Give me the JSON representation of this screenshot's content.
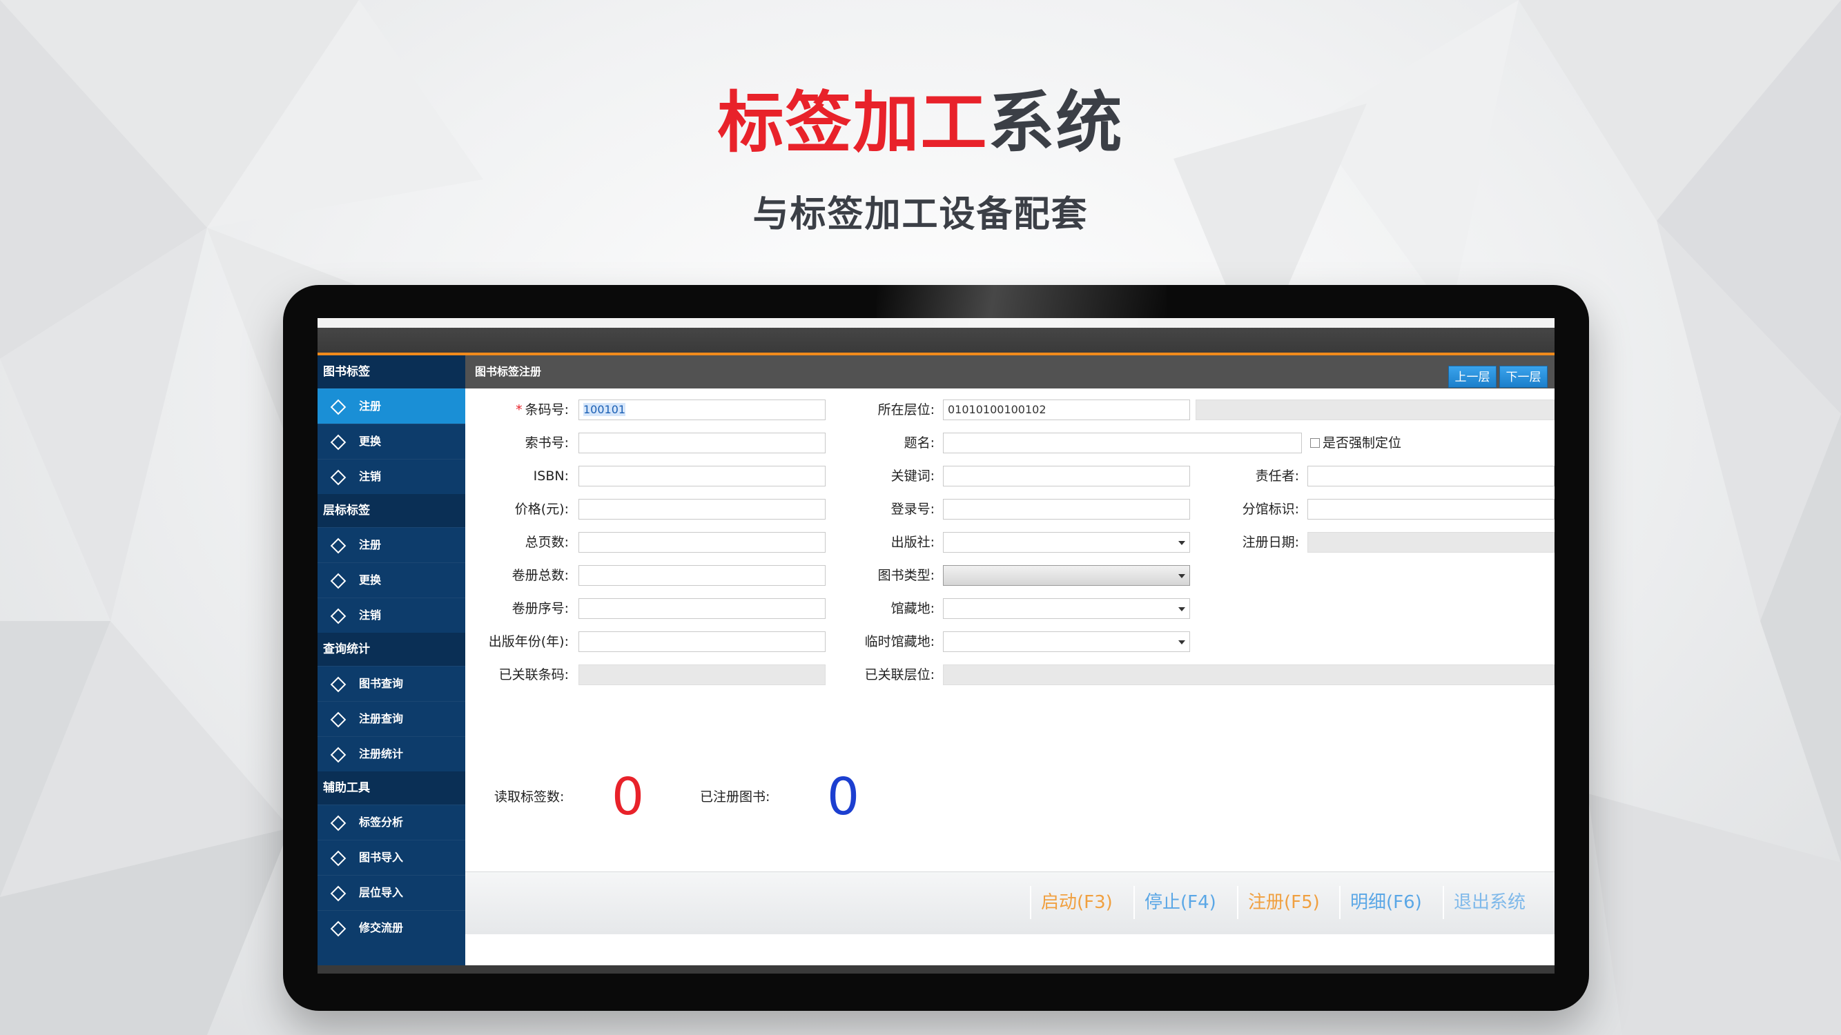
{
  "headline": {
    "accent": "标签加工",
    "rest": "系统"
  },
  "subheadline": "与标签加工设备配套",
  "app": {
    "content_title": "图书标签注册",
    "sidebar": [
      {
        "header": "图书标签",
        "items": [
          {
            "label": "注册",
            "active": true
          },
          {
            "label": "更换"
          },
          {
            "label": "注销"
          }
        ]
      },
      {
        "header": "层标标签",
        "items": [
          {
            "label": "注册"
          },
          {
            "label": "更换"
          },
          {
            "label": "注销"
          }
        ]
      },
      {
        "header": "查询统计",
        "items": [
          {
            "label": "图书查询"
          },
          {
            "label": "注册查询"
          },
          {
            "label": "注册统计"
          }
        ]
      },
      {
        "header": "辅助工具",
        "items": [
          {
            "label": "标签分析"
          },
          {
            "label": "图书导入"
          },
          {
            "label": "层位导入"
          },
          {
            "label": "修交流册"
          }
        ]
      }
    ],
    "form": {
      "barcode": {
        "label": "条码号:",
        "value": "100101"
      },
      "location": {
        "label": "所在层位:",
        "value": "01010100100102"
      },
      "prev_button": "上一层",
      "next_button": "下一层",
      "call_no": {
        "label": "索书号:",
        "value": ""
      },
      "title": {
        "label": "题名:",
        "value": ""
      },
      "force_locate": "是否强制定位",
      "isbn": {
        "label": "ISBN:",
        "value": ""
      },
      "keywords": {
        "label": "关键词:",
        "value": ""
      },
      "responsible": {
        "label": "责任者:",
        "value": ""
      },
      "price": {
        "label": "价格(元):",
        "value": ""
      },
      "accession": {
        "label": "登录号:",
        "value": ""
      },
      "branch": {
        "label": "分馆标识:",
        "value": ""
      },
      "pages": {
        "label": "总页数:",
        "value": ""
      },
      "publisher": {
        "label": "出版社:",
        "value": ""
      },
      "reg_date": {
        "label": "注册日期:",
        "value": ""
      },
      "volumes": {
        "label": "卷册总数:",
        "value": ""
      },
      "book_type": {
        "label": "图书类型:",
        "value": ""
      },
      "volume_no": {
        "label": "卷册序号:",
        "value": ""
      },
      "collection": {
        "label": "馆藏地:",
        "value": ""
      },
      "pub_year": {
        "label": "出版年份(年):",
        "value": ""
      },
      "temp_collection": {
        "label": "临时馆藏地:",
        "value": ""
      },
      "linked_barcode": {
        "label": "已关联条码:",
        "value": ""
      },
      "linked_location": {
        "label": "已关联层位:",
        "value": ""
      }
    },
    "counters": {
      "tags_read_label": "读取标签数:",
      "tags_read_value": "0",
      "registered_label": "已注册图书:",
      "registered_value": "0"
    },
    "function_keys": [
      {
        "label": "启动(F3)",
        "color": "orange"
      },
      {
        "label": "停止(F4)",
        "color": "blue"
      },
      {
        "label": "注册(F5)",
        "color": "orange"
      },
      {
        "label": "明细(F6)",
        "color": "blue"
      },
      {
        "label": "退出系统",
        "color": "blue"
      }
    ]
  }
}
